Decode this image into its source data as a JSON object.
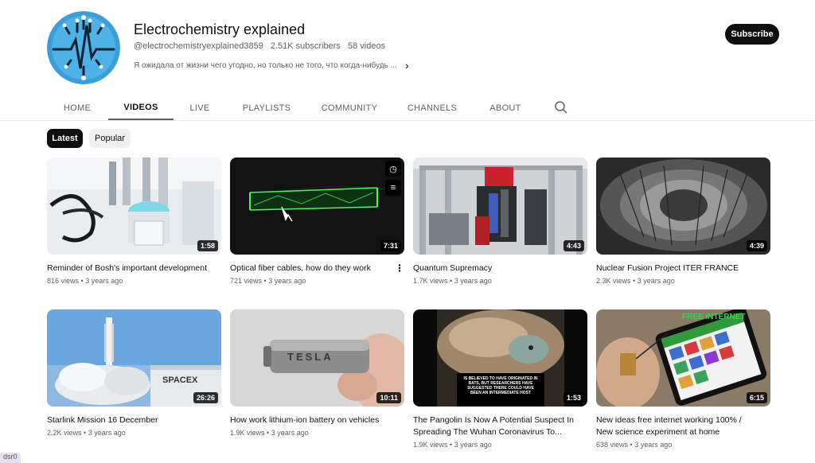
{
  "channel": {
    "name": "Electrochemistry explained",
    "handle": "@electrochemistryexplained3859",
    "subscribers": "2.51K subscribers",
    "video_count": "58 videos",
    "description": "Я ожидала от жизни чего угодно, но только не того, что когда-нибудь ...",
    "subscribe_label": "Subscribe",
    "avatar_icon": "circuit-pulse-logo-icon"
  },
  "tabs": [
    {
      "label": "HOME"
    },
    {
      "label": "VIDEOS"
    },
    {
      "label": "LIVE"
    },
    {
      "label": "PLAYLISTS"
    },
    {
      "label": "COMMUNITY"
    },
    {
      "label": "CHANNELS"
    },
    {
      "label": "ABOUT"
    }
  ],
  "filters": {
    "latest": "Latest",
    "popular": "Popular"
  },
  "videos": [
    {
      "title": "Reminder of Bosh's important development",
      "views": "816 views",
      "age": "3 years ago",
      "duration": "1:58"
    },
    {
      "title": "Optical fiber cables, how do they work",
      "views": "721 views",
      "age": "3 years ago",
      "duration": "7:31"
    },
    {
      "title": "Quantum Supremacy",
      "views": "1.7K views",
      "age": "3 years ago",
      "duration": "4:43"
    },
    {
      "title": "Nuclear Fusion Project ITER FRANCE",
      "views": "2.3K views",
      "age": "3 years ago",
      "duration": "4:39"
    },
    {
      "title": "Starlink Mission 16 December",
      "views": "2.2K views",
      "age": "3 years ago",
      "duration": "26:26"
    },
    {
      "title": "How work lithium-ion battery on vehicles",
      "views": "1.9K views",
      "age": "3 years ago",
      "duration": "10:11"
    },
    {
      "title": "The Pangolin Is Now A Potential Suspect In Spreading The Wuhan Coronavirus To...",
      "views": "1.9K views",
      "age": "3 years ago",
      "duration": "1:53"
    },
    {
      "title": "New ideas free internet working 100% / New science experiment at home",
      "views": "638 views",
      "age": "3 years ago",
      "duration": "6:15"
    }
  ],
  "thumb_text": {
    "spacex": "SPACEX",
    "tesla": "TESLA",
    "pangolin_caption": "IS BELIEVED TO HAVE ORIGINATED IN BATS, BUT RESEARCHERS HAVE SUGGESTED THERE COULD HAVE BEEN AN INTERMEDIATE HOST",
    "internet": "FREE INTERNET"
  },
  "corner_tag": "dsr0"
}
